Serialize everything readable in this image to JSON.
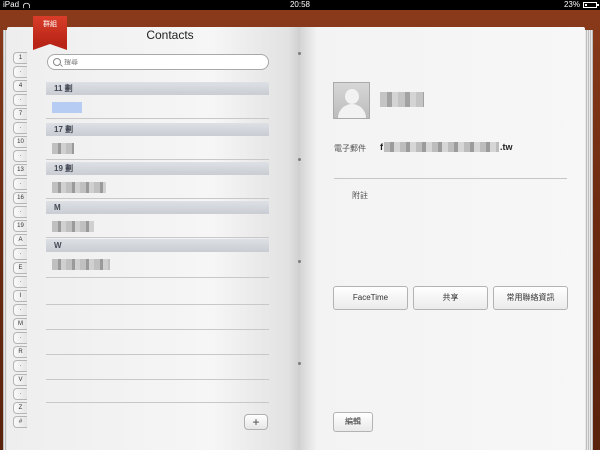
{
  "status_bar": {
    "device": "iPad",
    "time": "20:58",
    "battery": "23%",
    "battery_level": 0.23
  },
  "bookmark": {
    "label": "群組"
  },
  "title": "Contacts",
  "search": {
    "placeholder": "搜尋"
  },
  "index_tabs": [
    "1",
    "·",
    "4",
    "·",
    "7",
    "·",
    "10",
    "·",
    "13",
    "·",
    "16",
    "·",
    "19",
    "A",
    "·",
    "E",
    "·",
    "I",
    "·",
    "M",
    "·",
    "R",
    "·",
    "V",
    "·",
    "Z",
    "#"
  ],
  "sections": [
    {
      "header": "11 劃"
    },
    {
      "header": "17 劃"
    },
    {
      "header": "19 劃"
    },
    {
      "header": "M"
    },
    {
      "header": "W"
    }
  ],
  "add_button": "+",
  "details": {
    "email_label": "電子郵件",
    "email_prefix": "f",
    "email_suffix": ".tw",
    "notes_label": "附註"
  },
  "actions": {
    "facetime": "FaceTime",
    "share": "共享",
    "favorite": "常用聯絡資訊"
  },
  "edit_button": "編輯"
}
